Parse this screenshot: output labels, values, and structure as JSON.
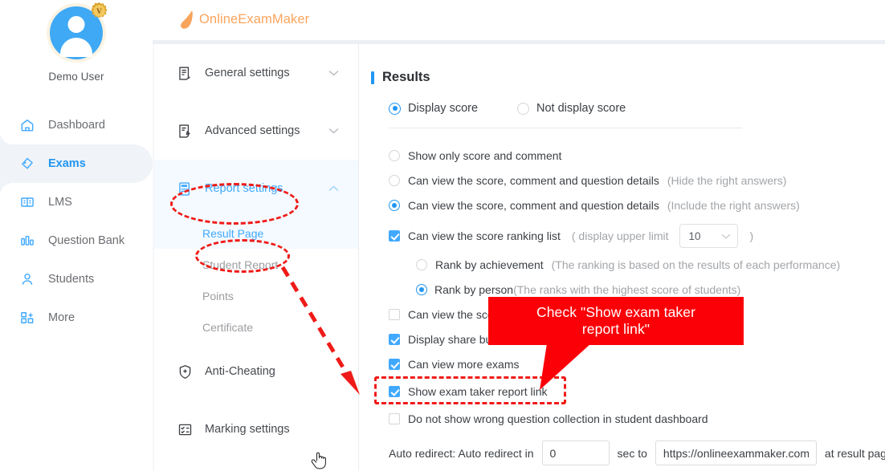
{
  "app": {
    "logo_text": "OnlineExamMaker",
    "brand_color": "#fba45c",
    "accent_color": "#2196f3",
    "annotation_color": "#ef1b18"
  },
  "profile": {
    "name": "Demo User",
    "badge": "V"
  },
  "sidebar": {
    "items": [
      {
        "label": "Dashboard",
        "icon": "home-icon",
        "active": false
      },
      {
        "label": "Exams",
        "icon": "exam-tag-icon",
        "active": true
      },
      {
        "label": "LMS",
        "icon": "book-icon",
        "active": false
      },
      {
        "label": "Question Bank",
        "icon": "bar-chart-icon",
        "active": false
      },
      {
        "label": "Students",
        "icon": "user-icon",
        "active": false
      },
      {
        "label": "More",
        "icon": "grid-more-icon",
        "active": false
      }
    ]
  },
  "settings_nav": {
    "groups": [
      {
        "label": "General settings",
        "icon": "document-icon",
        "expanded": false,
        "active": false
      },
      {
        "label": "Advanced settings",
        "icon": "document-edit-icon",
        "expanded": false,
        "active": false
      },
      {
        "label": "Report settings",
        "icon": "report-icon",
        "expanded": true,
        "active": true
      }
    ],
    "sub_items": [
      {
        "label": "Result Page",
        "active": true
      },
      {
        "label": "Student Report",
        "active": false
      },
      {
        "label": "Points",
        "active": false
      },
      {
        "label": "Certificate",
        "active": false
      }
    ],
    "groups_after": [
      {
        "label": "Anti-Cheating",
        "icon": "shield-plus-icon",
        "expanded": false,
        "active": false
      },
      {
        "label": "Marking settings",
        "icon": "marking-icon",
        "expanded": false,
        "active": false
      }
    ]
  },
  "results": {
    "title": "Results",
    "display_mode": [
      {
        "label": "Display score",
        "checked": true
      },
      {
        "label": "Not display score",
        "checked": false
      }
    ],
    "detail_options": [
      {
        "label": "Show only score and comment",
        "hint": "",
        "checked": false
      },
      {
        "label": "Can view the score, comment and question details",
        "hint": "(Hide the right answers)",
        "checked": false
      },
      {
        "label": "Can view the score, comment and question details",
        "hint": "(Include the right answers)",
        "checked": true
      }
    ],
    "ranking": {
      "label": "Can view the score ranking list",
      "checked": true,
      "limit_prefix": "( display upper limit",
      "limit_value": "10",
      "limit_suffix": ")",
      "modes": [
        {
          "label": "Rank by achievement",
          "hint": "(The ranking is based on the results of each performance)",
          "checked": false
        },
        {
          "label": "Rank by person",
          "hint": "(The ranks with the highest score of students)",
          "checked": true
        }
      ]
    },
    "checkboxes": [
      {
        "label": "Can view the sco",
        "checked": false,
        "occluded": true
      },
      {
        "label": "Display share bu",
        "checked": true,
        "occluded": true
      },
      {
        "label": "Can view more exams",
        "checked": true,
        "occluded": false
      },
      {
        "label": "Show exam taker report link",
        "checked": true,
        "occluded": false,
        "highlighted": true
      },
      {
        "label": "Do not show wrong question collection in student dashboard",
        "checked": false,
        "occluded": false
      }
    ],
    "redirect": {
      "prefix": "Auto redirect: Auto redirect in",
      "seconds_value": "0",
      "mid": "sec to",
      "url_value": "https://onlineexammaker.com/",
      "suffix": "at result page"
    }
  },
  "annotations": {
    "callout_text": "Check \"Show exam taker report link\"",
    "callout_line1": "Check \"Show exam taker",
    "callout_line2": "report link\""
  }
}
